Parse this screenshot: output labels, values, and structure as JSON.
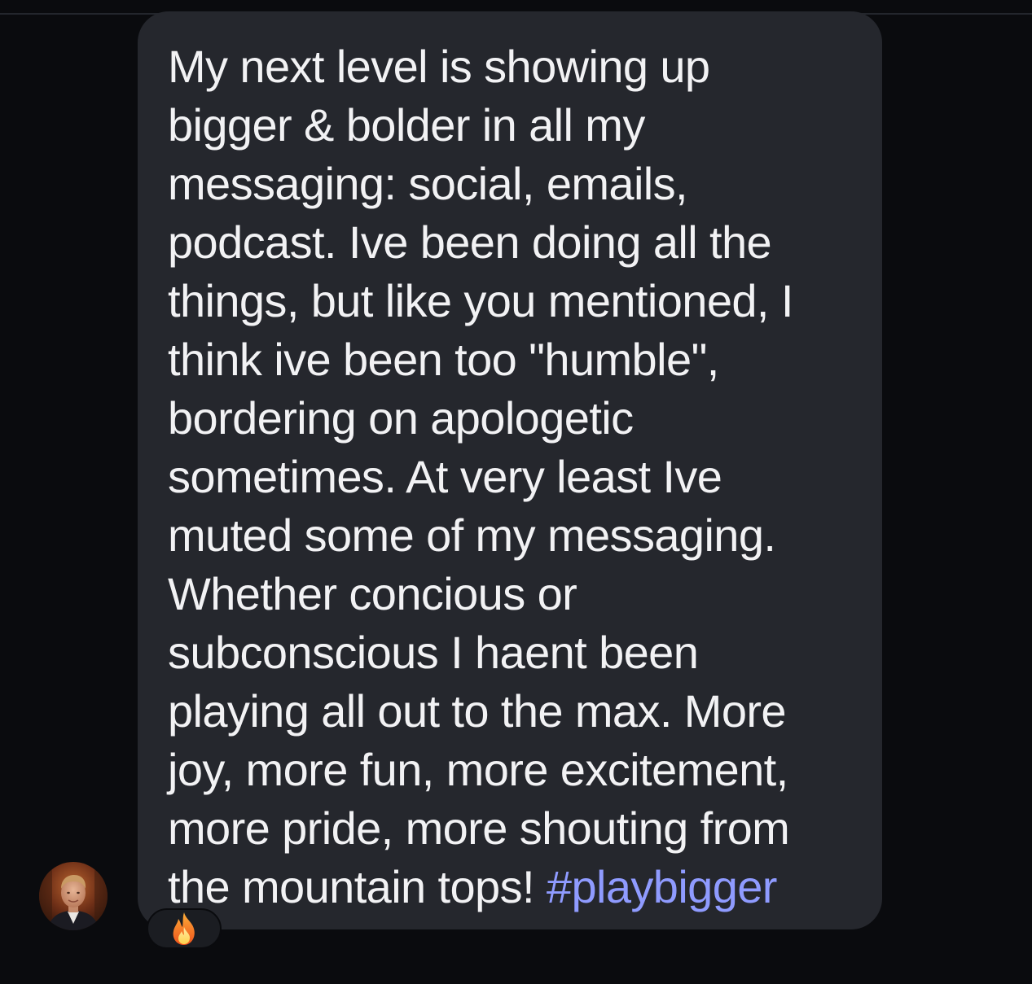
{
  "message": {
    "lines": [
      "My next level is showing up",
      "bigger & bolder in all my",
      "messaging: social, emails,",
      "podcast. Ive been doing all the",
      "things, but like you mentioned, I",
      "think ive been too \"humble\",",
      "bordering on apologetic",
      "sometimes. At very least Ive",
      "muted some of my messaging.",
      "Whether concious or",
      "subconscious I haent been",
      "playing all out to the max. More",
      "joy, more fun, more excitement,",
      "more pride, more shouting from",
      "the mountain tops! "
    ],
    "hashtag": "#playbigger"
  },
  "reaction": {
    "emoji": "🔥",
    "icon": "fire-icon"
  },
  "sender": {
    "avatar_icon": "avatar"
  },
  "colors": {
    "background": "#0a0b0e",
    "bubble": "#25272d",
    "text": "#f2f2f4",
    "hashtag": "#8f9bff"
  }
}
